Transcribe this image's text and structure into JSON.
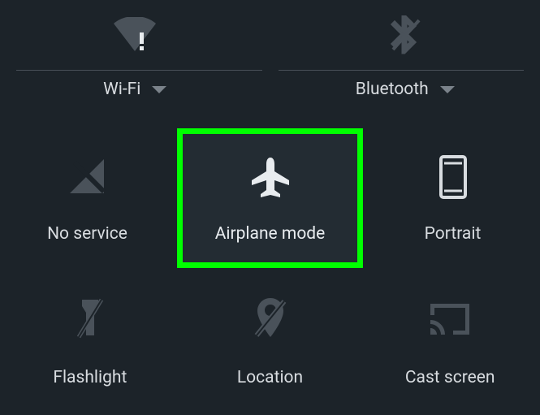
{
  "quicksettings": {
    "top": {
      "wifi": {
        "label": "Wi-Fi"
      },
      "bluetooth": {
        "label": "Bluetooth"
      }
    },
    "mid": {
      "noservice": {
        "label": "No service"
      },
      "airplane": {
        "label": "Airplane mode"
      },
      "portrait": {
        "label": "Portrait"
      }
    },
    "bottom": {
      "flashlight": {
        "label": "Flashlight"
      },
      "location": {
        "label": "Location"
      },
      "cast": {
        "label": "Cast screen"
      }
    }
  }
}
